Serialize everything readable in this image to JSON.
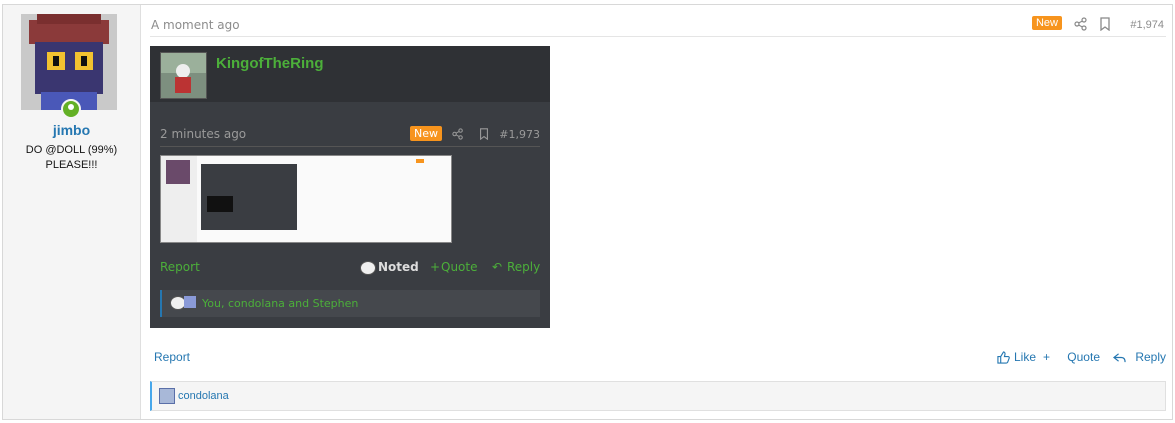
{
  "post": {
    "user": {
      "name": "jimbo",
      "title_line1": "DO @DOLL (99%)",
      "title_line2": "PLEASE!!!"
    },
    "header": {
      "timestamp": "A moment ago",
      "badge": "New",
      "post_number": "#1,974"
    },
    "embedded_screenshot": {
      "username": "KingofTheRing",
      "timestamp": "2 minutes ago",
      "badge": "New",
      "post_number": "#1,973",
      "report_label": "Report",
      "noted_label": "Noted",
      "quote_label": "Quote",
      "reply_label": "Reply",
      "reactions_text": "You, condolana and Stephen"
    },
    "footer": {
      "report_label": "Report",
      "like_label": "Like",
      "quote_label": "Quote",
      "reply_label": "Reply"
    },
    "reactions": {
      "text": "condolana"
    }
  },
  "colors": {
    "accent": "#2577b1",
    "badge": "#f7941d",
    "online": "#63b025",
    "green_username": "#4caf3a"
  }
}
